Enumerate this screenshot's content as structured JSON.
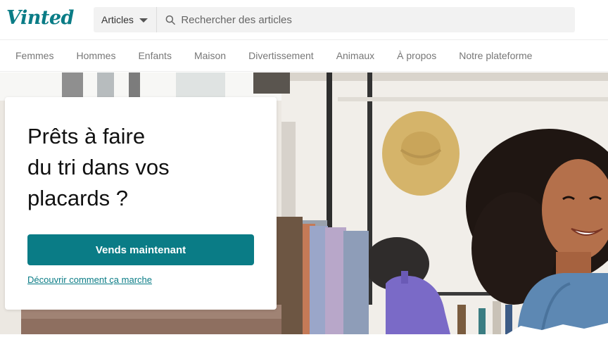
{
  "header": {
    "logo": "Vinted",
    "search": {
      "category_label": "Articles",
      "placeholder": "Rechercher des articles"
    }
  },
  "nav": {
    "items": [
      {
        "label": "Femmes"
      },
      {
        "label": "Hommes"
      },
      {
        "label": "Enfants"
      },
      {
        "label": "Maison"
      },
      {
        "label": "Divertissement"
      },
      {
        "label": "Animaux"
      },
      {
        "label": "À propos"
      },
      {
        "label": "Notre plateforme"
      }
    ]
  },
  "hero": {
    "title_line1": "Prêts à faire",
    "title_line2": "du tri dans vos",
    "title_line3": "placards ?",
    "cta_label": "Vends maintenant",
    "link_label": "Découvrir comment ça marche"
  },
  "colors": {
    "brand": "#0a7c86"
  }
}
